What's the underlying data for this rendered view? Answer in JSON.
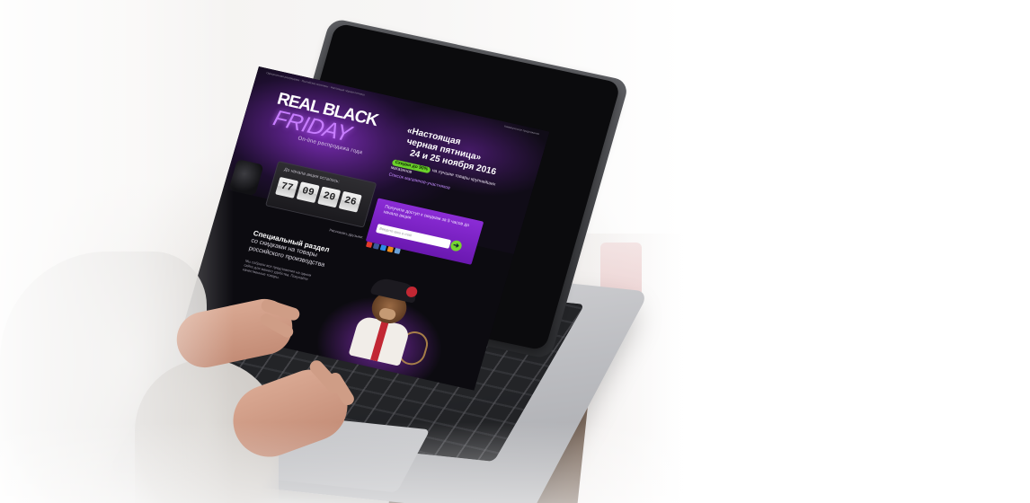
{
  "screen": {
    "topbar_left": "Официальная распродажа · Российские магазины · Настоящая чёрная пятница",
    "topbar_right": "Коммерческое предложение",
    "logo": {
      "line1": "REAL BLACK",
      "line2": "FRIDAY",
      "tagline": "On-line распродажа года"
    },
    "headline": {
      "line1": "«Настоящая",
      "line2": "черная пятница»",
      "line3": "24 и 25 ноября 2016"
    },
    "discount": {
      "pill": "Скидки до 90%",
      "text": "на лучшие товары крупнейших магазинов"
    },
    "stores_link": "Список магазинов-участников",
    "timer": {
      "label": "До начала акции осталось:",
      "digits": [
        "77",
        "09",
        "20",
        "26"
      ]
    },
    "promo": {
      "text": "Получите доступ к скидкам за 5 часов до начала акции",
      "input_placeholder": "Введите ваш e-mail",
      "submit_glyph": "➔"
    },
    "share_label": "Рассказать друзьям:",
    "social_colors": [
      "#e23b2b",
      "#3b5998",
      "#2d8ae6",
      "#ef8b1c",
      "#6aa0d8"
    ],
    "special": {
      "title": "Специальный раздел",
      "subtitle": "со скидками на товары российского производства",
      "body": "Мы собрали все предложения на одном сайте для вашего удобства. Покупайте качественные товары."
    }
  },
  "colors": {
    "accent_purple": "#8b2cd6",
    "accent_green": "#6ad12a",
    "screen_bg": "#0c0b10"
  }
}
